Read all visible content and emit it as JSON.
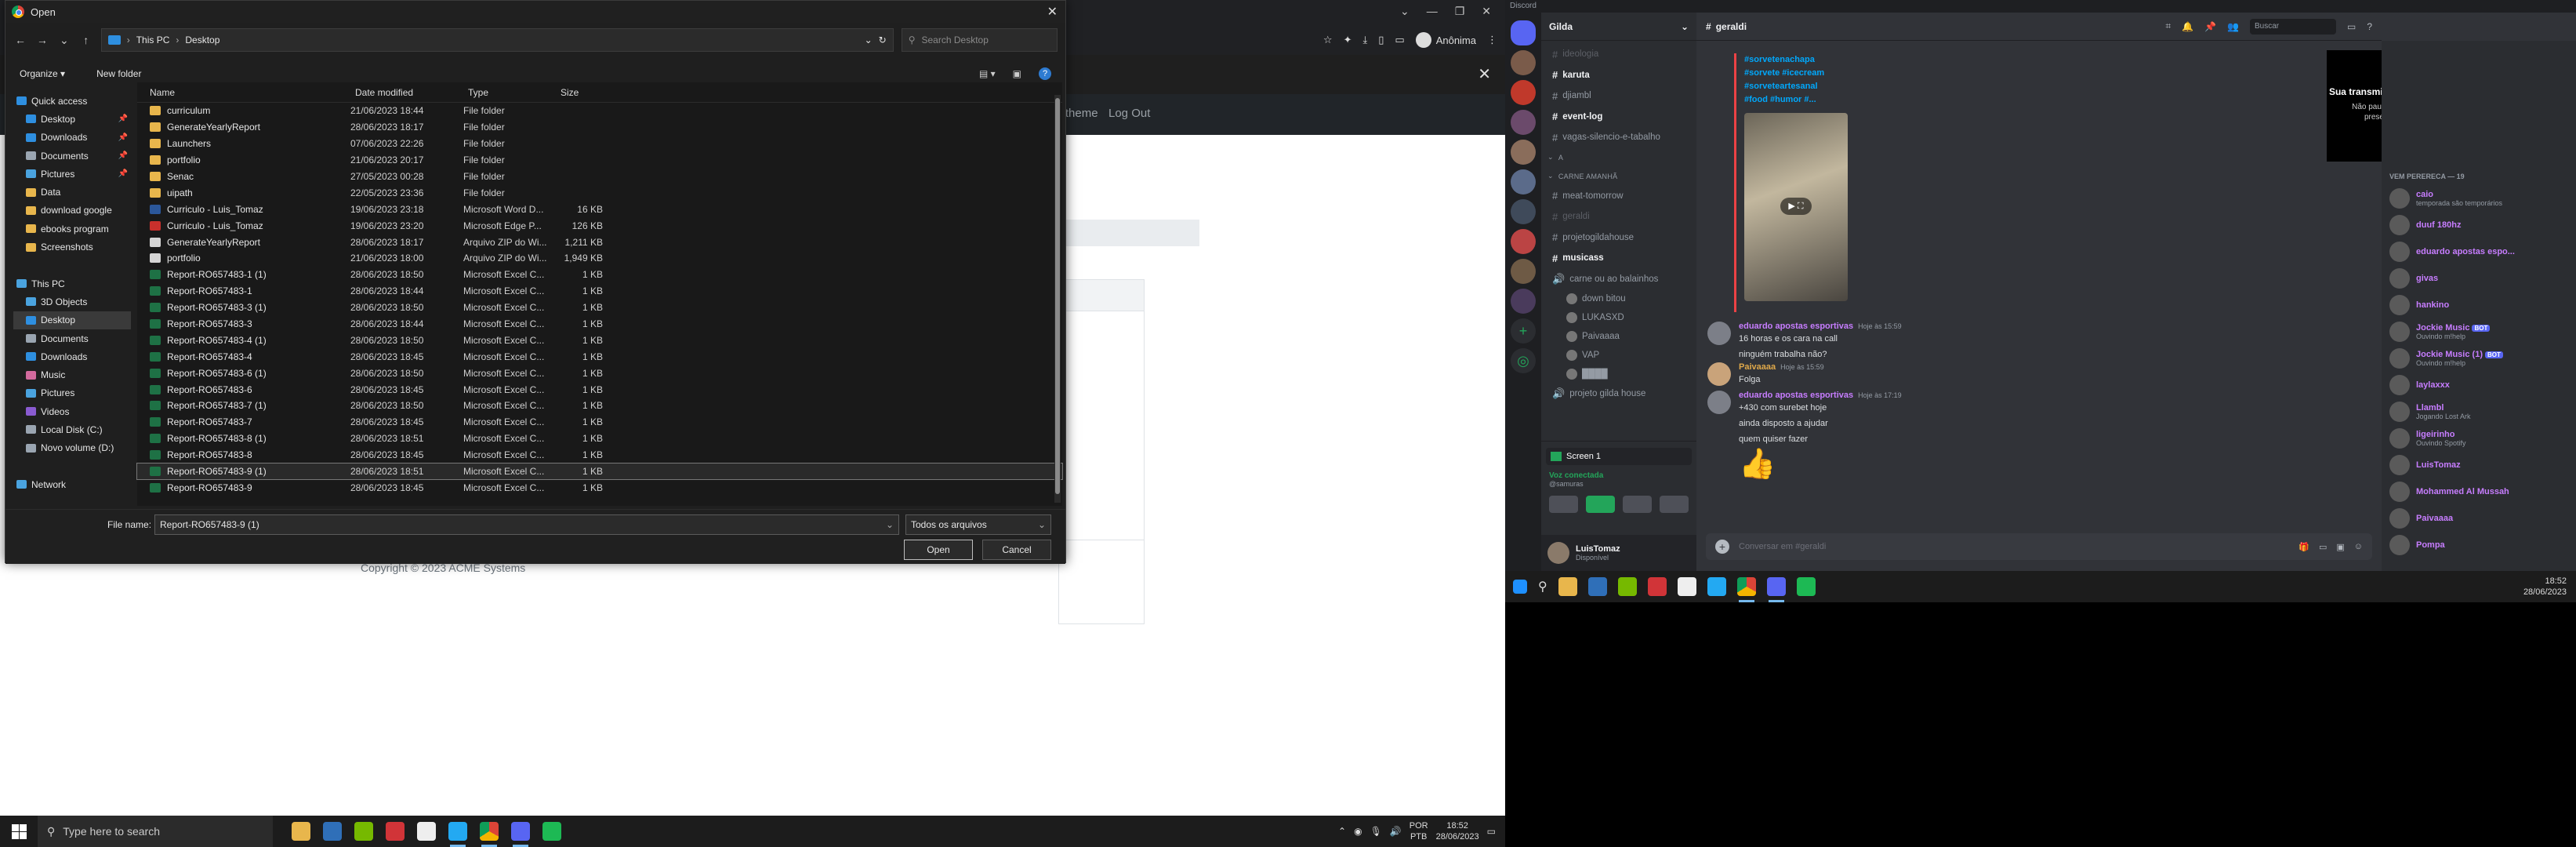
{
  "browser": {
    "incognito_label": "Anônima",
    "nav_links": [
      "n to new theme",
      "Log Out"
    ],
    "copyright": "Copyright © 2023 ACME Systems"
  },
  "dialog": {
    "title": "Open",
    "path": [
      "This PC",
      "Desktop"
    ],
    "search_placeholder": "Search Desktop",
    "organize_label": "Organize",
    "new_folder_label": "New folder",
    "nav_items": [
      {
        "label": "Quick access",
        "kind": "star"
      },
      {
        "label": "Desktop",
        "kind": "desktop",
        "pinned": true,
        "selected": false
      },
      {
        "label": "Downloads",
        "kind": "download",
        "pinned": true
      },
      {
        "label": "Documents",
        "kind": "doc",
        "pinned": true
      },
      {
        "label": "Pictures",
        "kind": "pic",
        "pinned": true
      },
      {
        "label": "Data",
        "kind": "folder"
      },
      {
        "label": "download google",
        "kind": "folder"
      },
      {
        "label": "ebooks program",
        "kind": "folder"
      },
      {
        "label": "Screenshots",
        "kind": "folder"
      },
      {
        "label": "",
        "kind": "spacer"
      },
      {
        "label": "This PC",
        "kind": "pc"
      },
      {
        "label": "3D Objects",
        "kind": "obj"
      },
      {
        "label": "Desktop",
        "kind": "desktop",
        "selected": true
      },
      {
        "label": "Documents",
        "kind": "doc"
      },
      {
        "label": "Downloads",
        "kind": "download"
      },
      {
        "label": "Music",
        "kind": "music"
      },
      {
        "label": "Pictures",
        "kind": "pic"
      },
      {
        "label": "Videos",
        "kind": "video"
      },
      {
        "label": "Local Disk (C:)",
        "kind": "disk"
      },
      {
        "label": "Novo volume (D:)",
        "kind": "disk"
      },
      {
        "label": "",
        "kind": "spacer"
      },
      {
        "label": "Network",
        "kind": "net"
      }
    ],
    "columns": [
      "Name",
      "Date modified",
      "Type",
      "Size"
    ],
    "files": [
      {
        "name": "curriculum",
        "date": "21/06/2023 18:44",
        "type": "File folder",
        "size": "",
        "icon": "folder"
      },
      {
        "name": "GenerateYearlyReport",
        "date": "28/06/2023 18:17",
        "type": "File folder",
        "size": "",
        "icon": "folder"
      },
      {
        "name": "Launchers",
        "date": "07/06/2023 22:26",
        "type": "File folder",
        "size": "",
        "icon": "folder"
      },
      {
        "name": "portfolio",
        "date": "21/06/2023 20:17",
        "type": "File folder",
        "size": "",
        "icon": "folder"
      },
      {
        "name": "Senac",
        "date": "27/05/2023 00:28",
        "type": "File folder",
        "size": "",
        "icon": "folder"
      },
      {
        "name": "uipath",
        "date": "22/05/2023 23:36",
        "type": "File folder",
        "size": "",
        "icon": "folder"
      },
      {
        "name": "Curriculo - Luis_Tomaz",
        "date": "19/06/2023 23:18",
        "type": "Microsoft Word D...",
        "size": "16 KB",
        "icon": "word"
      },
      {
        "name": "Curriculo - Luis_Tomaz",
        "date": "19/06/2023 23:20",
        "type": "Microsoft Edge P...",
        "size": "126 KB",
        "icon": "pdf"
      },
      {
        "name": "GenerateYearlyReport",
        "date": "28/06/2023 18:17",
        "type": "Arquivo ZIP do Wi...",
        "size": "1,211 KB",
        "icon": "zip"
      },
      {
        "name": "portfolio",
        "date": "21/06/2023 18:00",
        "type": "Arquivo ZIP do Wi...",
        "size": "1,949 KB",
        "icon": "zip"
      },
      {
        "name": "Report-RO657483-1 (1)",
        "date": "28/06/2023 18:50",
        "type": "Microsoft Excel C...",
        "size": "1 KB",
        "icon": "excel"
      },
      {
        "name": "Report-RO657483-1",
        "date": "28/06/2023 18:44",
        "type": "Microsoft Excel C...",
        "size": "1 KB",
        "icon": "excel"
      },
      {
        "name": "Report-RO657483-3 (1)",
        "date": "28/06/2023 18:50",
        "type": "Microsoft Excel C...",
        "size": "1 KB",
        "icon": "excel"
      },
      {
        "name": "Report-RO657483-3",
        "date": "28/06/2023 18:44",
        "type": "Microsoft Excel C...",
        "size": "1 KB",
        "icon": "excel"
      },
      {
        "name": "Report-RO657483-4 (1)",
        "date": "28/06/2023 18:50",
        "type": "Microsoft Excel C...",
        "size": "1 KB",
        "icon": "excel"
      },
      {
        "name": "Report-RO657483-4",
        "date": "28/06/2023 18:45",
        "type": "Microsoft Excel C...",
        "size": "1 KB",
        "icon": "excel"
      },
      {
        "name": "Report-RO657483-6 (1)",
        "date": "28/06/2023 18:50",
        "type": "Microsoft Excel C...",
        "size": "1 KB",
        "icon": "excel"
      },
      {
        "name": "Report-RO657483-6",
        "date": "28/06/2023 18:45",
        "type": "Microsoft Excel C...",
        "size": "1 KB",
        "icon": "excel"
      },
      {
        "name": "Report-RO657483-7 (1)",
        "date": "28/06/2023 18:50",
        "type": "Microsoft Excel C...",
        "size": "1 KB",
        "icon": "excel"
      },
      {
        "name": "Report-RO657483-7",
        "date": "28/06/2023 18:45",
        "type": "Microsoft Excel C...",
        "size": "1 KB",
        "icon": "excel"
      },
      {
        "name": "Report-RO657483-8 (1)",
        "date": "28/06/2023 18:51",
        "type": "Microsoft Excel C...",
        "size": "1 KB",
        "icon": "excel"
      },
      {
        "name": "Report-RO657483-8",
        "date": "28/06/2023 18:45",
        "type": "Microsoft Excel C...",
        "size": "1 KB",
        "icon": "excel"
      },
      {
        "name": "Report-RO657483-9 (1)",
        "date": "28/06/2023 18:51",
        "type": "Microsoft Excel C...",
        "size": "1 KB",
        "icon": "excel",
        "selected": true
      },
      {
        "name": "Report-RO657483-9",
        "date": "28/06/2023 18:45",
        "type": "Microsoft Excel C...",
        "size": "1 KB",
        "icon": "excel"
      }
    ],
    "filename_label": "File name:",
    "filename_value": "Report-RO657483-9 (1)",
    "filter_value": "Todos os arquivos",
    "open_label": "Open",
    "cancel_label": "Cancel"
  },
  "taskbar_left": {
    "search_placeholder": "Type here to search",
    "lang": "POR",
    "layout": "PTB",
    "time": "18:52",
    "date": "28/06/2023"
  },
  "discord": {
    "app_title": "Discord",
    "server_name": "Gilda",
    "channel_name": "geraldi",
    "search_placeholder": "Buscar",
    "channels": [
      {
        "label": "ideologia",
        "kind": "text",
        "style": "dim"
      },
      {
        "label": "karuta",
        "kind": "text",
        "style": "bright"
      },
      {
        "label": "djiambl",
        "kind": "text",
        "style": "normal"
      },
      {
        "label": "event-log",
        "kind": "text",
        "style": "bright"
      },
      {
        "label": "vagas-silencio-e-tabalho",
        "kind": "text",
        "style": "normal"
      },
      {
        "label": "A",
        "kind": "cat"
      },
      {
        "label": "CARNE AMANHÃ",
        "kind": "cat"
      },
      {
        "label": "meat-tomorrow",
        "kind": "text",
        "style": "normal"
      },
      {
        "label": "geraldi",
        "kind": "text",
        "style": "dim"
      },
      {
        "label": "projetogildahouse",
        "kind": "text",
        "style": "normal"
      },
      {
        "label": "musicass",
        "kind": "text",
        "style": "bright"
      },
      {
        "label": "carne ou ao balainhos",
        "kind": "voice",
        "style": "normal"
      },
      {
        "label": "down bitou",
        "kind": "user"
      },
      {
        "label": "LUKASXD",
        "kind": "user"
      },
      {
        "label": "Paivaaaa",
        "kind": "user"
      },
      {
        "label": "VAP",
        "kind": "user"
      },
      {
        "label": "████",
        "kind": "user"
      },
      {
        "label": "projeto gilda house",
        "kind": "voice",
        "style": "normal"
      }
    ],
    "voice_screen": "Screen 1",
    "voice_status": "Voz conectada",
    "voice_sub": "@samuras",
    "user_name": "LuisTomaz",
    "user_status": "Disponível",
    "embed_tags": [
      "#sorvetenachapa",
      "#sorvete #icecream",
      "#sorveteartesanal",
      "#food #humor #..."
    ],
    "messages": [
      {
        "author": "eduardo apostas esportivas",
        "color": "#c77dff",
        "time": "Hoje às 15:59",
        "lines": [
          "16 horas e os cara na call",
          "ninguém trabalha não?"
        ]
      },
      {
        "author": "Paivaaaa",
        "color": "#e0a94a",
        "time": "Hoje às 15:59",
        "lines": [
          "Folga"
        ]
      },
      {
        "author": "eduardo apostas esportivas",
        "color": "#c77dff",
        "time": "Hoje às 17:19",
        "lines": [
          "+430 com surebet hoje",
          "ainda disposto a ajudar",
          "quem quiser fazer"
        ]
      }
    ],
    "composer_placeholder": "Conversar em #geraldi",
    "stream_title": "Sua transmissão ainda está ligada!",
    "stream_body": "Não pausamos esta prévia para preservar seus recursos.",
    "member_category": "VEM PERERECA — 19",
    "members": [
      {
        "name": "caio",
        "sub": "temporada são temporários",
        "color": "#c77dff"
      },
      {
        "name": "duuf 180hz",
        "sub": "",
        "color": "#c77dff"
      },
      {
        "name": "eduardo apostas espo...",
        "sub": "",
        "color": "#c77dff"
      },
      {
        "name": "givas",
        "sub": "",
        "color": "#c77dff"
      },
      {
        "name": "hankino",
        "sub": "",
        "color": "#c77dff"
      },
      {
        "name": "Jockie Music",
        "sub": "Ouvindo m!help",
        "color": "#c77dff",
        "bot": "BOT"
      },
      {
        "name": "Jockie Music (1)",
        "sub": "Ouvindo m!help",
        "color": "#c77dff",
        "bot": "BOT"
      },
      {
        "name": "laylaxxx",
        "sub": "",
        "color": "#c77dff"
      },
      {
        "name": "Llambl",
        "sub": "Jogando Lost Ark",
        "color": "#c77dff"
      },
      {
        "name": "ligeirinho",
        "sub": "Ouvindo Spotify",
        "color": "#c77dff"
      },
      {
        "name": "LuisTomaz",
        "sub": "",
        "color": "#c77dff"
      },
      {
        "name": "Mohammed Al Mussah",
        "sub": "",
        "color": "#c77dff"
      },
      {
        "name": "Paivaaaa",
        "sub": "",
        "color": "#c77dff"
      },
      {
        "name": "Pompa",
        "sub": "",
        "color": "#c77dff"
      }
    ],
    "time": "18:52",
    "date": "28/06/2023"
  }
}
